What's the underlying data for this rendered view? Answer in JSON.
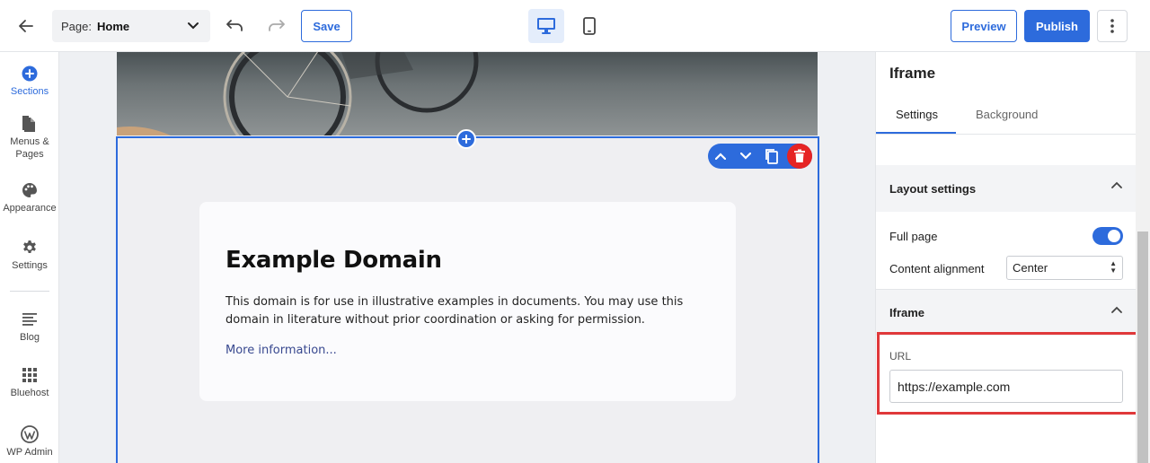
{
  "toolbar": {
    "page_label": "Page:",
    "page_value": "Home",
    "save_label": "Save",
    "preview_label": "Preview",
    "publish_label": "Publish"
  },
  "sidebar": {
    "items": [
      {
        "label": "Sections",
        "icon": "plus-circle-icon"
      },
      {
        "label": "Menus &\nPages",
        "icon": "pages-icon"
      },
      {
        "label": "Appearance",
        "icon": "palette-icon"
      },
      {
        "label": "Settings",
        "icon": "gear-icon"
      },
      {
        "label": "Blog",
        "icon": "blog-lines-icon"
      },
      {
        "label": "Bluehost",
        "icon": "grid-icon"
      },
      {
        "label": "WP Admin",
        "icon": "wordpress-icon"
      }
    ]
  },
  "content": {
    "heading": "Example Domain",
    "paragraph": "This domain is for use in illustrative examples in documents. You may use this domain in literature without prior coordination or asking for permission.",
    "link": "More information..."
  },
  "panel": {
    "title": "Iframe",
    "tabs": [
      "Settings",
      "Background"
    ],
    "layout_section": "Layout settings",
    "full_page_label": "Full page",
    "full_page_on": true,
    "content_alignment_label": "Content alignment",
    "content_alignment_value": "Center",
    "iframe_section": "Iframe",
    "url_label": "URL",
    "url_value": "https://example.com"
  },
  "colors": {
    "accent": "#2d6bdc",
    "delete": "#e62424",
    "highlight": "#e0383a"
  }
}
